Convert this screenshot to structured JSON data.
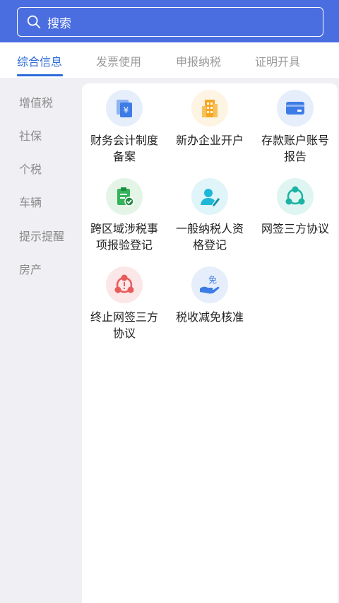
{
  "search": {
    "placeholder": "搜索"
  },
  "tabs": [
    {
      "label": "综合信息"
    },
    {
      "label": "发票使用"
    },
    {
      "label": "申报纳税"
    },
    {
      "label": "证明开具"
    }
  ],
  "sidebar": {
    "items": [
      {
        "label": "增值税"
      },
      {
        "label": "社保"
      },
      {
        "label": "个税"
      },
      {
        "label": "车辆"
      },
      {
        "label": "提示提醒"
      },
      {
        "label": "房产"
      }
    ]
  },
  "services": [
    {
      "label": "财务会计制度\n备案",
      "icon": "finance-document-icon",
      "color": "#3d7ce6"
    },
    {
      "label": "新办企业开户",
      "icon": "building-icon",
      "color": "#f5a623"
    },
    {
      "label": "存款账户账号\n报告",
      "icon": "bank-card-icon",
      "color": "#3d7ce6"
    },
    {
      "label": "跨区域涉税事\n项报验登记",
      "icon": "clipboard-check-icon",
      "color": "#34b35a"
    },
    {
      "label": "一般纳税人资\n格登记",
      "icon": "person-edit-icon",
      "color": "#1fb7d8"
    },
    {
      "label": "网签三方协议",
      "icon": "three-party-icon",
      "color": "#1bb3a3"
    },
    {
      "label": "终止网签三方\n协议",
      "icon": "terminate-three-party-icon",
      "color": "#e85b5b"
    },
    {
      "label": "税收减免核准",
      "icon": "tax-exemption-icon",
      "color": "#3d7ce6",
      "icon_text": "免"
    }
  ]
}
